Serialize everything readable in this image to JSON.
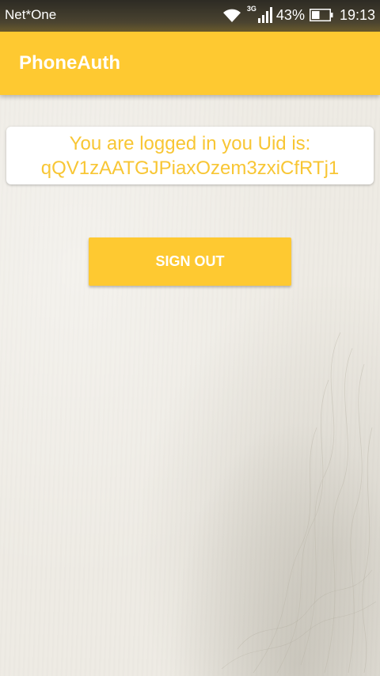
{
  "status_bar": {
    "carrier": "Net*One",
    "network_type": "3G",
    "battery_percent": "43%",
    "battery_level": 0.43,
    "time": "19:13",
    "icons": [
      "wifi-icon",
      "signal-icon",
      "battery-icon"
    ]
  },
  "app_bar": {
    "title": "PhoneAuth",
    "color": "#fec931"
  },
  "main": {
    "message_line1": "You are logged in you Uid is:",
    "uid": "qQV1zAATGJPiaxOzem3zxiCfRTj1",
    "text_color": "#f8c634",
    "sign_out_label": "SIGN OUT"
  }
}
